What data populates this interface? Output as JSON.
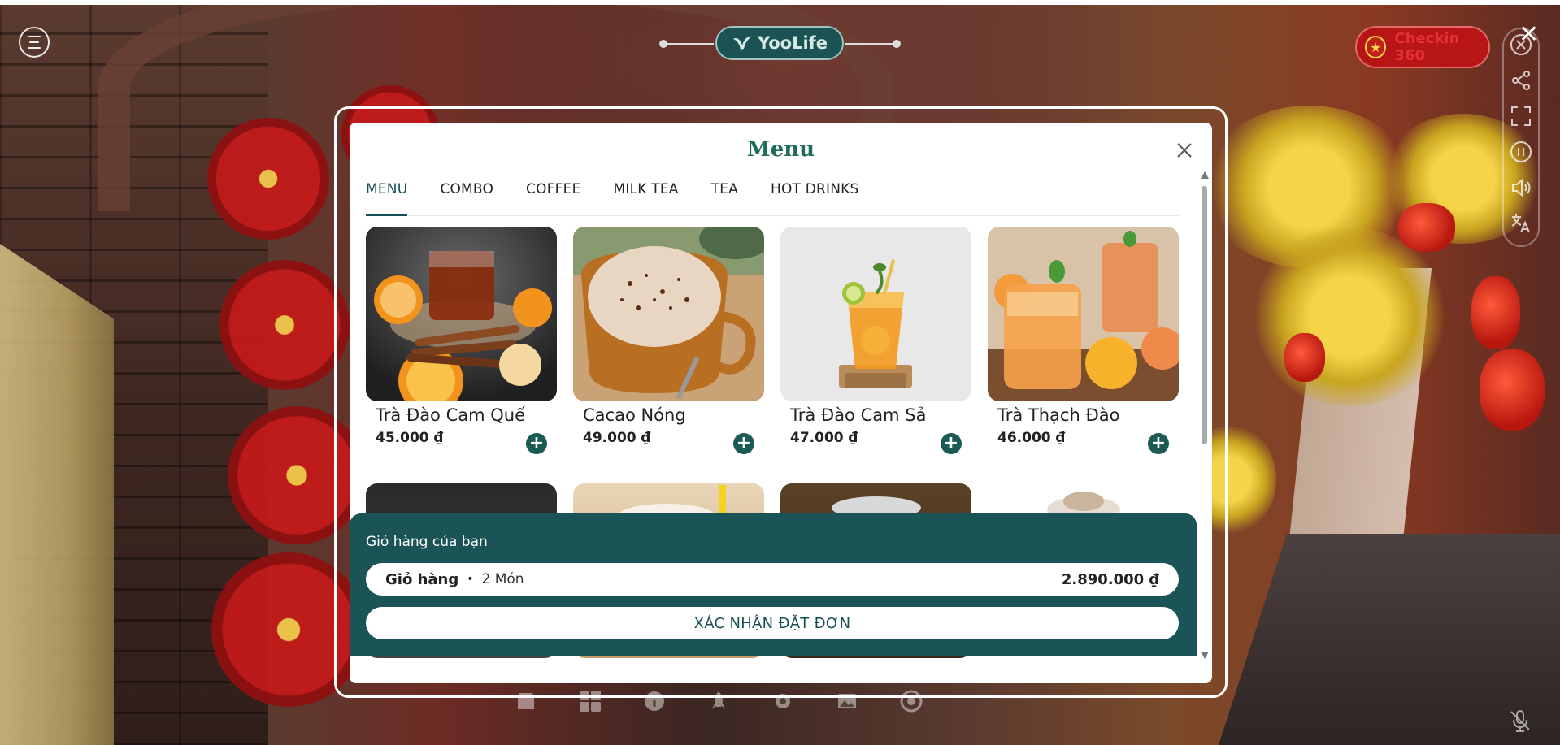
{
  "header": {
    "logo_text": "YooLife",
    "checkin_label": "Checkin 360"
  },
  "modal": {
    "title": "Menu",
    "tabs": [
      {
        "label": "MENU",
        "active": true
      },
      {
        "label": "COMBO",
        "active": false
      },
      {
        "label": "COFFEE",
        "active": false
      },
      {
        "label": "MILK TEA",
        "active": false
      },
      {
        "label": "TEA",
        "active": false
      },
      {
        "label": "HOT DRINKS",
        "active": false
      }
    ],
    "items": [
      {
        "name": "Trà Đào Cam Quế",
        "price": "45.000 ₫"
      },
      {
        "name": "Cacao Nóng",
        "price": "49.000 ₫"
      },
      {
        "name": "Trà Đào Cam Sả",
        "price": "47.000 ₫"
      },
      {
        "name": "Trà Thạch Đào",
        "price": "46.000 ₫"
      }
    ]
  },
  "cart": {
    "title": "Giỏ hàng của bạn",
    "label": "Giỏ hàng",
    "separator": "•",
    "count": "2 Món",
    "total": "2.890.000 ₫",
    "confirm_label": "XÁC NHẬN ĐẶT ĐƠN"
  },
  "colors": {
    "brand": "#1b5457",
    "title_green": "#1f6b5a",
    "checkin_red": "#b81616"
  },
  "icons": {
    "side_tools": [
      "close-circle-icon",
      "share-icon",
      "fullscreen-icon",
      "pause-icon",
      "volume-icon",
      "translate-icon"
    ],
    "bottom_bar": [
      "shop-icon",
      "grid-icon",
      "info-icon",
      "rocket-icon",
      "settings-icon",
      "gallery-icon",
      "camera-360-icon"
    ]
  }
}
